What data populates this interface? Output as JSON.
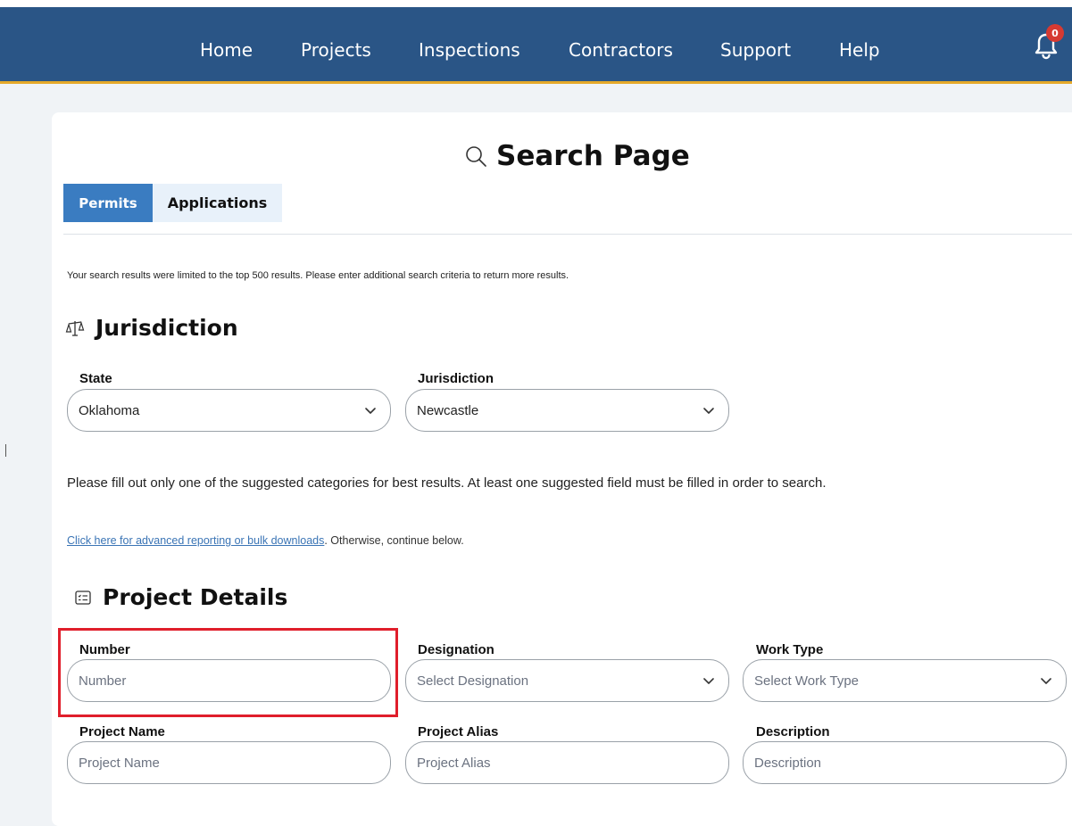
{
  "nav": {
    "items": [
      "Home",
      "Projects",
      "Inspections",
      "Contractors",
      "Support",
      "Help"
    ],
    "notification_count": "0"
  },
  "page": {
    "title": "Search Page",
    "tabs": [
      {
        "label": "Permits",
        "active": true
      },
      {
        "label": "Applications",
        "active": false
      }
    ],
    "notice": "Your search results were limited to the top 500 results. Please enter additional search criteria to return more results."
  },
  "jurisdiction": {
    "section_title": "Jurisdiction",
    "state_label": "State",
    "state_value": "Oklahoma",
    "jurisdiction_label": "Jurisdiction",
    "jurisdiction_value": "Newcastle"
  },
  "hint": "Please fill out only one of the suggested categories for best results. At least one suggested field must be filled in order to search.",
  "advanced": {
    "link_text": "Click here for advanced reporting or bulk downloads",
    "suffix": ". Otherwise, continue below."
  },
  "project_details": {
    "section_title": "Project Details",
    "number_label": "Number",
    "number_placeholder": "Number",
    "designation_label": "Designation",
    "designation_placeholder": "Select Designation",
    "work_type_label": "Work Type",
    "work_type_placeholder": "Select Work Type",
    "project_name_label": "Project Name",
    "project_name_placeholder": "Project Name",
    "project_alias_label": "Project Alias",
    "project_alias_placeholder": "Project Alias",
    "description_label": "Description",
    "description_placeholder": "Description"
  },
  "colors": {
    "header": "#2a5586",
    "header_accent": "#e5a92a",
    "tab_active": "#3a7cc1",
    "highlight": "#e01e2b"
  }
}
